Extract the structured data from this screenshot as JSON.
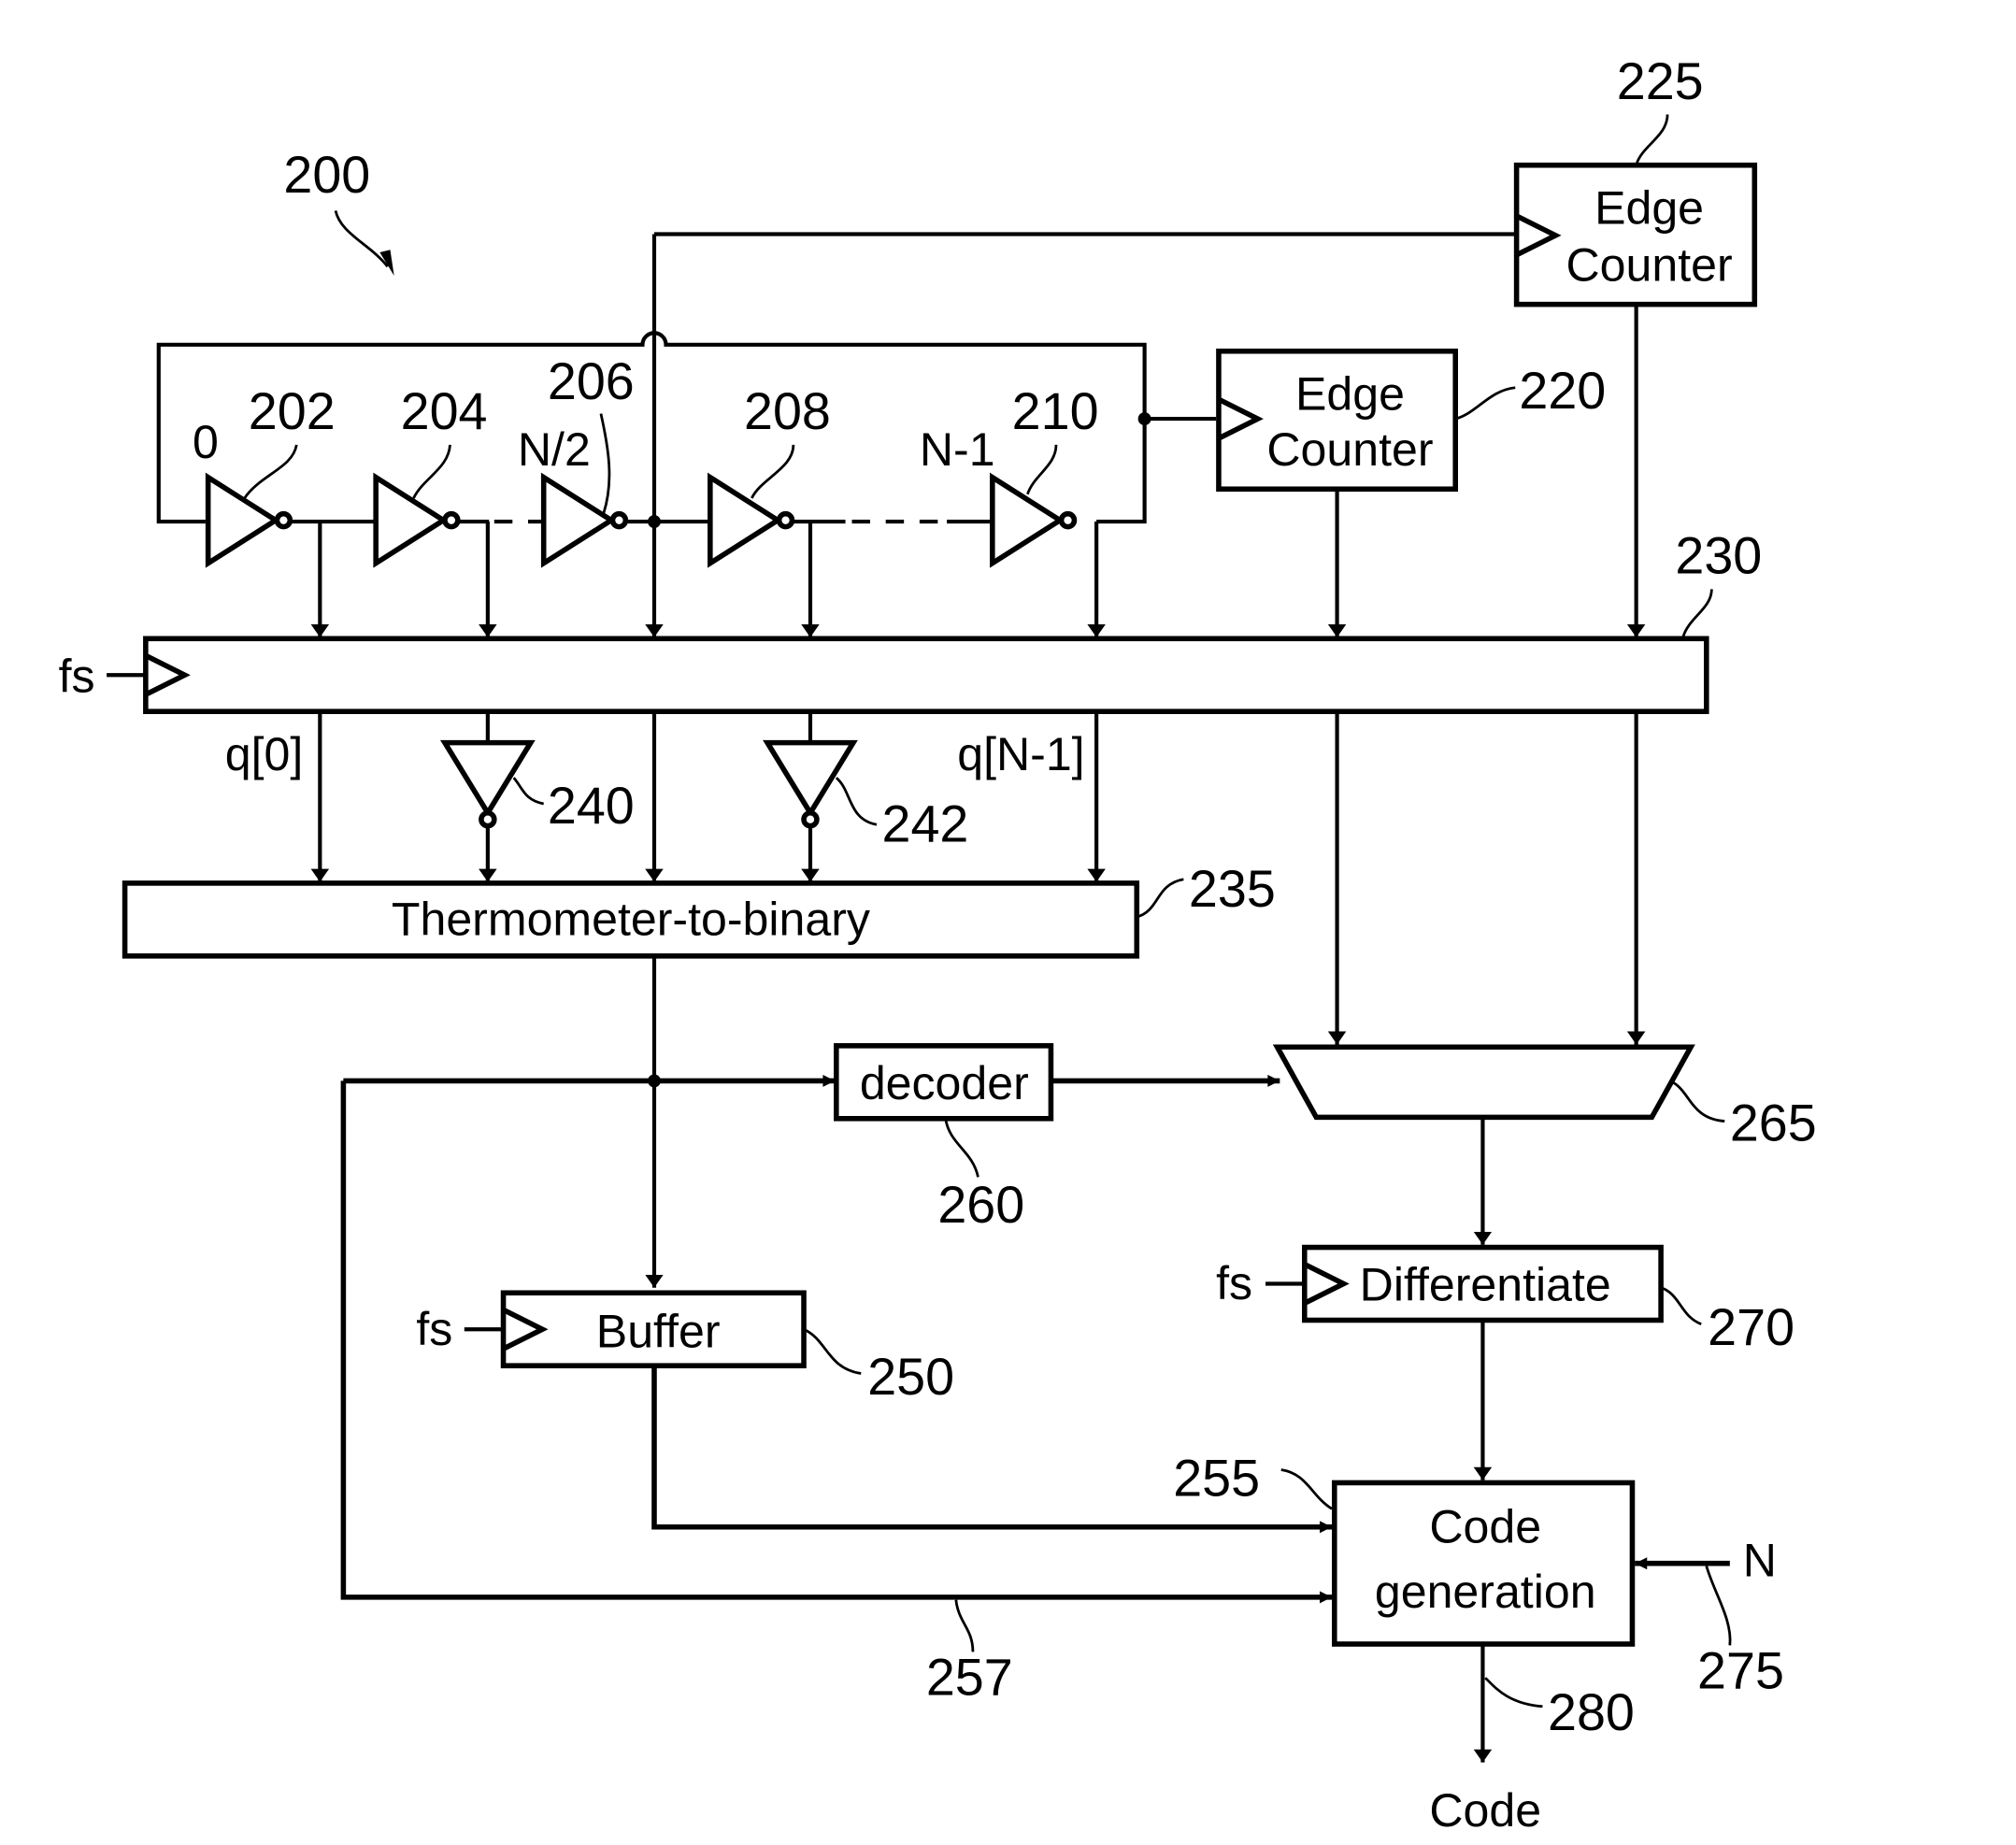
{
  "figure": {
    "ref": "200",
    "oscillator": {
      "inverters": [
        {
          "ref": "202",
          "index_label": "0"
        },
        {
          "ref": "204",
          "index_label": ""
        },
        {
          "ref": "206",
          "index_label": "N/2"
        },
        {
          "ref": "208",
          "index_label": ""
        },
        {
          "ref": "210",
          "index_label": "N-1"
        }
      ]
    },
    "edge_counter_1": {
      "ref": "220",
      "line1": "Edge",
      "line2": "Counter"
    },
    "edge_counter_2": {
      "ref": "225",
      "line1": "Edge",
      "line2": "Counter"
    },
    "register": {
      "ref": "230",
      "clock_label": "fs"
    },
    "q_labels": {
      "first": "q[0]",
      "last": "q[N-1]"
    },
    "output_inverters": [
      {
        "ref": "240"
      },
      {
        "ref": "242"
      }
    ],
    "thermometer": {
      "ref": "235",
      "label": "Thermometer-to-binary"
    },
    "decoder": {
      "ref": "260",
      "label": "decoder"
    },
    "mux": {
      "ref": "265"
    },
    "differentiate": {
      "ref": "270",
      "label": "Differentiate",
      "clock_label": "fs"
    },
    "buffer": {
      "ref": "250",
      "label": "Buffer",
      "clock_label": "fs"
    },
    "code_generation": {
      "ref": "255",
      "line1": "Code",
      "line2": "generation"
    },
    "feedback_path": {
      "ref": "257"
    },
    "n_input": {
      "ref": "275",
      "label": "N"
    },
    "output": {
      "ref": "280",
      "label": "Code"
    }
  }
}
